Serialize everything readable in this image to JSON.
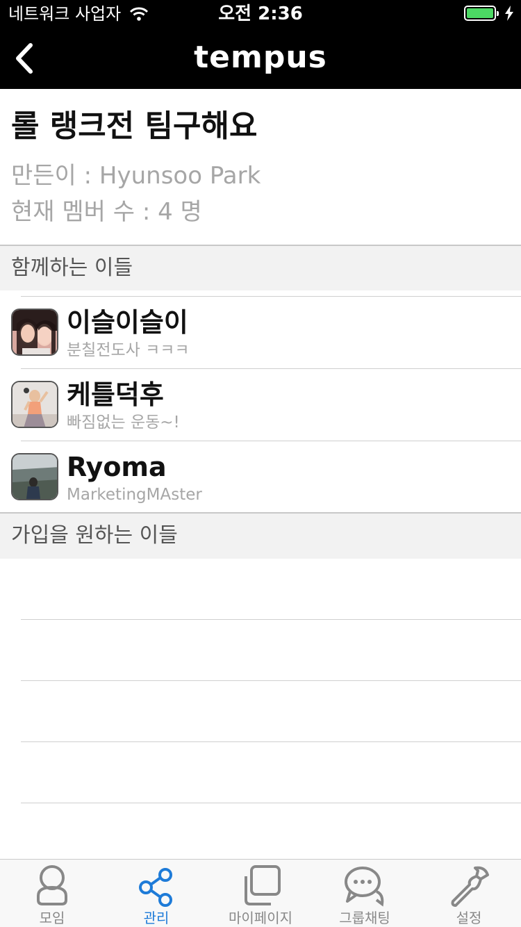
{
  "status_bar": {
    "carrier": "네트워크 사업자",
    "time": "오전 2:36"
  },
  "nav": {
    "title": "tempus"
  },
  "group": {
    "title": "롤 랭크전 팀구해요",
    "creator": "만든이 : Hyunsoo Park",
    "member_count": "현재 멤버 수 : 4 명"
  },
  "sections": {
    "members": "함께하는 이들",
    "applicants": "가입을 원하는 이들"
  },
  "members": [
    {
      "name": "이슬이슬이",
      "status": "분칠전도사 ㅋㅋㅋ"
    },
    {
      "name": "케틀덕후",
      "status": "빠짐없는 운동~!"
    },
    {
      "name": "Ryoma",
      "status": "MarketingMAster"
    }
  ],
  "tab_bar": {
    "items": [
      {
        "label": "모임",
        "icon": "person-icon"
      },
      {
        "label": "관리",
        "icon": "share-icon"
      },
      {
        "label": "마이페이지",
        "icon": "square-stack-icon"
      },
      {
        "label": "그룹채팅",
        "icon": "chat-bubbles-icon"
      },
      {
        "label": "설정",
        "icon": "wrench-icon"
      }
    ],
    "active_index": 1
  },
  "colors": {
    "accent": "#1e7bd8",
    "header_bg": "#000000",
    "battery": "#4cd964"
  }
}
